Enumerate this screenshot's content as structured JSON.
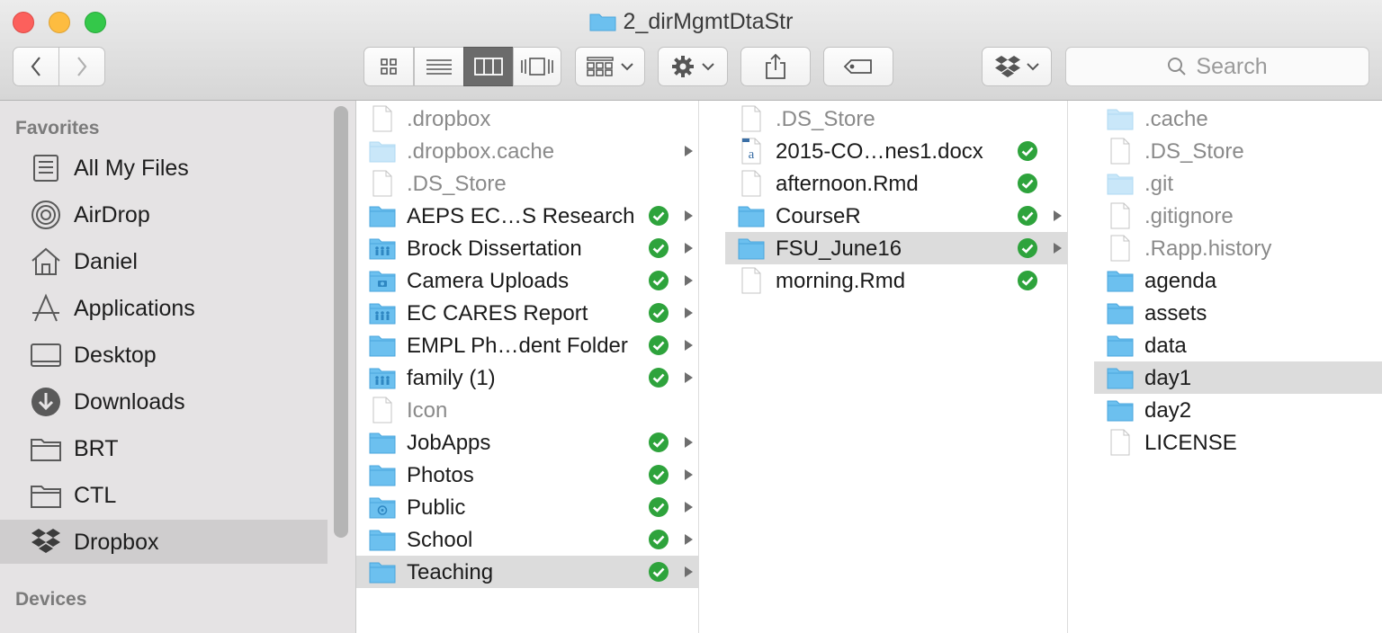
{
  "window": {
    "title": "2_dirMgmtDtaStr",
    "accent_folder": "#6cc0ef",
    "sync_green": "#2ea33c",
    "selection_gray": "#dcdcdc"
  },
  "toolbar": {
    "back_icon": "chevron-left-icon",
    "forward_icon": "chevron-right-icon",
    "view_modes": [
      "icon-view",
      "list-view",
      "column-view",
      "cover-flow-view"
    ],
    "active_view": "column-view",
    "arrange_icon": "arrange-grid-icon",
    "action_icon": "gear-icon",
    "share_icon": "share-icon",
    "tags_icon": "tag-icon",
    "dropbox_icon": "dropbox-icon",
    "search_placeholder": "Search"
  },
  "sidebar": {
    "favorites_label": "Favorites",
    "devices_label": "Devices",
    "items": [
      {
        "label": "All My Files",
        "icon": "all-files-icon"
      },
      {
        "label": "AirDrop",
        "icon": "airdrop-icon"
      },
      {
        "label": "Daniel",
        "icon": "home-icon"
      },
      {
        "label": "Applications",
        "icon": "applications-icon"
      },
      {
        "label": "Desktop",
        "icon": "desktop-icon"
      },
      {
        "label": "Downloads",
        "icon": "downloads-icon"
      },
      {
        "label": "BRT",
        "icon": "folder-icon"
      },
      {
        "label": "CTL",
        "icon": "folder-icon"
      },
      {
        "label": "Dropbox",
        "icon": "dropbox-icon",
        "selected": true
      }
    ]
  },
  "columns": [
    {
      "items": [
        {
          "name": ".dropbox",
          "kind": "file",
          "hidden": true
        },
        {
          "name": ".dropbox.cache",
          "kind": "folder",
          "hidden": true,
          "arrow": true
        },
        {
          "name": ".DS_Store",
          "kind": "file",
          "hidden": true
        },
        {
          "name": "AEPS EC…S Research",
          "kind": "folder",
          "synced": true,
          "arrow": true
        },
        {
          "name": "Brock Dissertation",
          "kind": "shared-folder",
          "synced": true,
          "arrow": true
        },
        {
          "name": "Camera Uploads",
          "kind": "camera-folder",
          "synced": true,
          "arrow": true
        },
        {
          "name": "EC CARES Report",
          "kind": "shared-folder",
          "synced": true,
          "arrow": true
        },
        {
          "name": "EMPL Ph…dent Folder",
          "kind": "folder",
          "synced": true,
          "arrow": true
        },
        {
          "name": "family (1)",
          "kind": "shared-folder",
          "synced": true,
          "arrow": true
        },
        {
          "name": "Icon",
          "kind": "file",
          "hidden": true
        },
        {
          "name": "JobApps",
          "kind": "folder",
          "synced": true,
          "arrow": true
        },
        {
          "name": "Photos",
          "kind": "folder",
          "synced": true,
          "arrow": true
        },
        {
          "name": "Public",
          "kind": "public-folder",
          "synced": true,
          "arrow": true
        },
        {
          "name": "School",
          "kind": "folder",
          "synced": true,
          "arrow": true
        },
        {
          "name": "Teaching",
          "kind": "folder",
          "synced": true,
          "arrow": true,
          "selected": true
        }
      ]
    },
    {
      "items": [
        {
          "name": ".DS_Store",
          "kind": "file",
          "hidden": true
        },
        {
          "name": "2015-CO…nes1.docx",
          "kind": "docx",
          "synced": true
        },
        {
          "name": "afternoon.Rmd",
          "kind": "file",
          "synced": true
        },
        {
          "name": "CourseR",
          "kind": "folder",
          "synced": true,
          "arrow": true
        },
        {
          "name": "FSU_June16",
          "kind": "folder",
          "synced": true,
          "arrow": true,
          "selected": true
        },
        {
          "name": "morning.Rmd",
          "kind": "file",
          "synced": true
        }
      ]
    },
    {
      "items": [
        {
          "name": ".cache",
          "kind": "folder",
          "hidden": true
        },
        {
          "name": ".DS_Store",
          "kind": "file",
          "hidden": true
        },
        {
          "name": ".git",
          "kind": "folder",
          "hidden": true
        },
        {
          "name": ".gitignore",
          "kind": "file",
          "hidden": true
        },
        {
          "name": ".Rapp.history",
          "kind": "file",
          "hidden": true
        },
        {
          "name": "agenda",
          "kind": "folder"
        },
        {
          "name": "assets",
          "kind": "folder"
        },
        {
          "name": "data",
          "kind": "folder"
        },
        {
          "name": "day1",
          "kind": "folder",
          "selected": true
        },
        {
          "name": "day2",
          "kind": "folder"
        },
        {
          "name": "LICENSE",
          "kind": "file"
        }
      ]
    }
  ]
}
